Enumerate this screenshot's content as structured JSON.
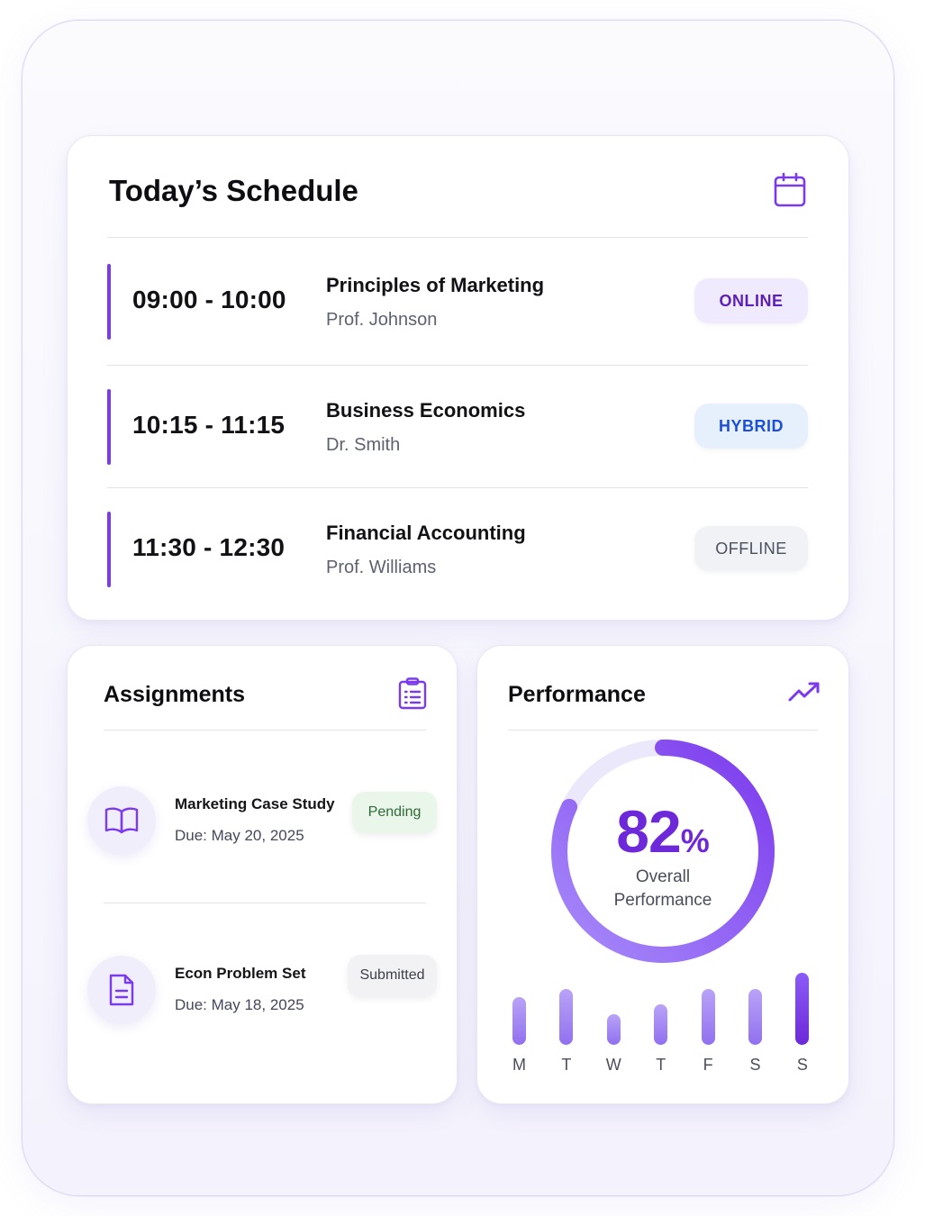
{
  "schedule": {
    "title": "Today’s Schedule",
    "items": [
      {
        "time": "09:00 - 10:00",
        "course": "Principles of Marketing",
        "instructor": "Prof. Johnson",
        "mode": "ONLINE"
      },
      {
        "time": "10:15 - 11:15",
        "course": "Business Economics",
        "instructor": "Dr. Smith",
        "mode": "HYBRID"
      },
      {
        "time": "11:30 - 12:30",
        "course": "Financial Accounting",
        "instructor": "Prof. Williams",
        "mode": "OFFLINE"
      }
    ]
  },
  "assignments": {
    "title": "Assignments",
    "items": [
      {
        "name": "Marketing Case Study",
        "due": "Due: May 20, 2025",
        "status": "Pending",
        "icon": "book-open-icon"
      },
      {
        "name": "Econ Problem Set",
        "due": "Due: May 18, 2025",
        "status": "Submitted",
        "icon": "document-icon"
      }
    ]
  },
  "performance": {
    "title": "Performance",
    "value": "82",
    "unit": "%",
    "label_line1": "Overall",
    "label_line2": "Performance",
    "progress": 0.82,
    "days": [
      "M",
      "T",
      "W",
      "T",
      "F",
      "S",
      "S"
    ],
    "day_levels": [
      0.66,
      0.78,
      0.42,
      0.56,
      0.78,
      0.78,
      1.0
    ]
  },
  "colors": {
    "accent": "#7c3aed",
    "accent_dark": "#6d28d9",
    "online_bg": "#efeafd",
    "hybrid_bg": "#e6f0fd",
    "offline_bg": "#f1f2f5",
    "pending_bg": "#eaf6ea",
    "submitted_bg": "#f2f2f4"
  },
  "icons": {
    "schedule": "calendar-icon",
    "assignments": "clipboard-list-icon",
    "performance": "trending-up-icon"
  }
}
